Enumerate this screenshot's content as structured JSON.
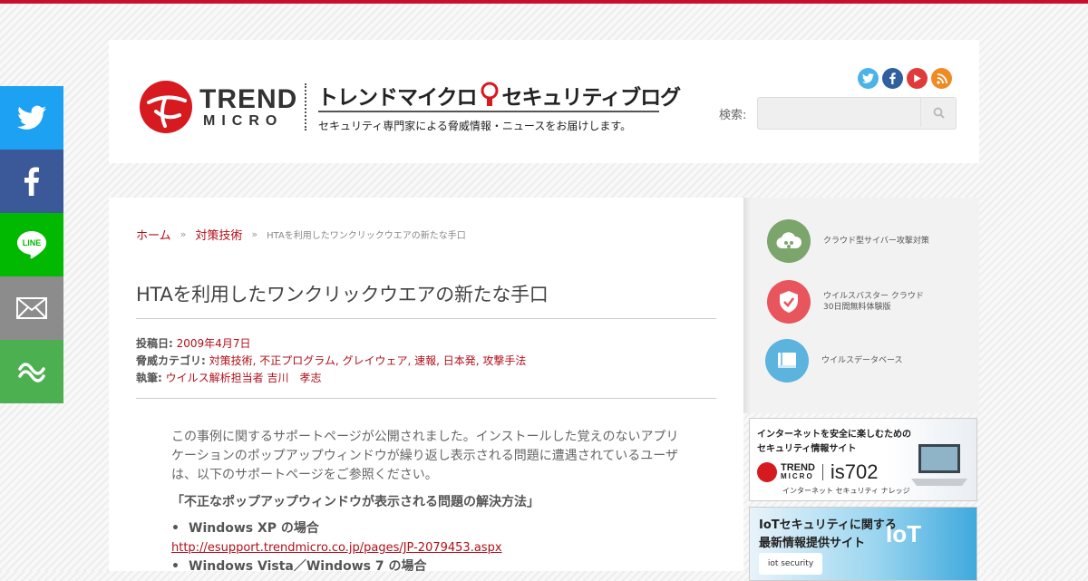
{
  "share": {
    "twitter": "twitter-icon",
    "facebook": "facebook-icon",
    "line_label": "LINE",
    "mail": "mail-icon",
    "more": "share-more-icon"
  },
  "header": {
    "logo_trend": "TREND",
    "logo_micro": "MICRO",
    "logo_tm": "™",
    "blog_title_a": "トレンドマイクロ",
    "blog_title_b": "セキュリティブログ",
    "tagline": "セキュリティ専門家による脅威情報・ニュースをお届けします。",
    "search_label": "検索:",
    "search_value": ""
  },
  "breadcrumb": {
    "home": "ホーム",
    "sep": "»",
    "category": "対策技術",
    "current": "HTAを利用したワンクリックウエアの新たな手口"
  },
  "article": {
    "title": "HTAを利用したワンクリックウエアの新たな手口",
    "meta": {
      "date_label": "投稿日:",
      "date": "2009年4月7日",
      "cat_label": "脅威カテゴリ:",
      "categories": "対策技術, 不正プログラム, グレイウェア, 速報, 日本発, 攻撃手法",
      "author_label": "執筆:",
      "author": "ウイルス解析担当者 吉川　孝志"
    },
    "intro": "この事例に関するサポートページが公開されました。インストールした覚えのないアプリケーションのポップアップウィンドウが繰り返し表示される問題に遭遇されているユーザは、以下のサポートページをご参照ください。",
    "support_title": "「不正なポップアップウィンドウが表示される問題の解決方法」",
    "items": [
      {
        "label": "Windows XP の場合",
        "url": "http://esupport.trendmicro.co.jp/pages/JP-2079453.aspx"
      },
      {
        "label": "Windows Vista／Windows 7 の場合",
        "url": ""
      }
    ]
  },
  "sidebar": {
    "items": [
      {
        "label": "クラウド型サイバー攻撃対策",
        "icon": "cloud-icon",
        "color": "#7ba56a"
      },
      {
        "label_1": "ウイルスバスター クラウド",
        "label_2": "30日間無料体験版",
        "icon": "shield-check-icon",
        "color": "#e8555d"
      },
      {
        "label": "ウイルスデータベース",
        "icon": "book-icon",
        "color": "#5bb3de"
      }
    ],
    "banner1": {
      "line1": "インターネットを安全に楽しむための",
      "line2": "セキュリティ情報サイト",
      "brand_trend": "TREND",
      "brand_micro": "MICRO",
      "site": "is702",
      "caption": "インターネット セキュリティ ナレッジ"
    },
    "banner2": {
      "line1": "IoTセキュリティに関する",
      "line2": "最新情報提供サイト",
      "iot": "IoT",
      "badge": "iot security"
    }
  },
  "colors": {
    "brand_red": "#c8102e",
    "link_red": "#b20f19",
    "twitter": "#1da1f2",
    "facebook": "#3b5998",
    "line": "#00b900",
    "mail": "#8c8c8c",
    "more": "#4caf50"
  }
}
